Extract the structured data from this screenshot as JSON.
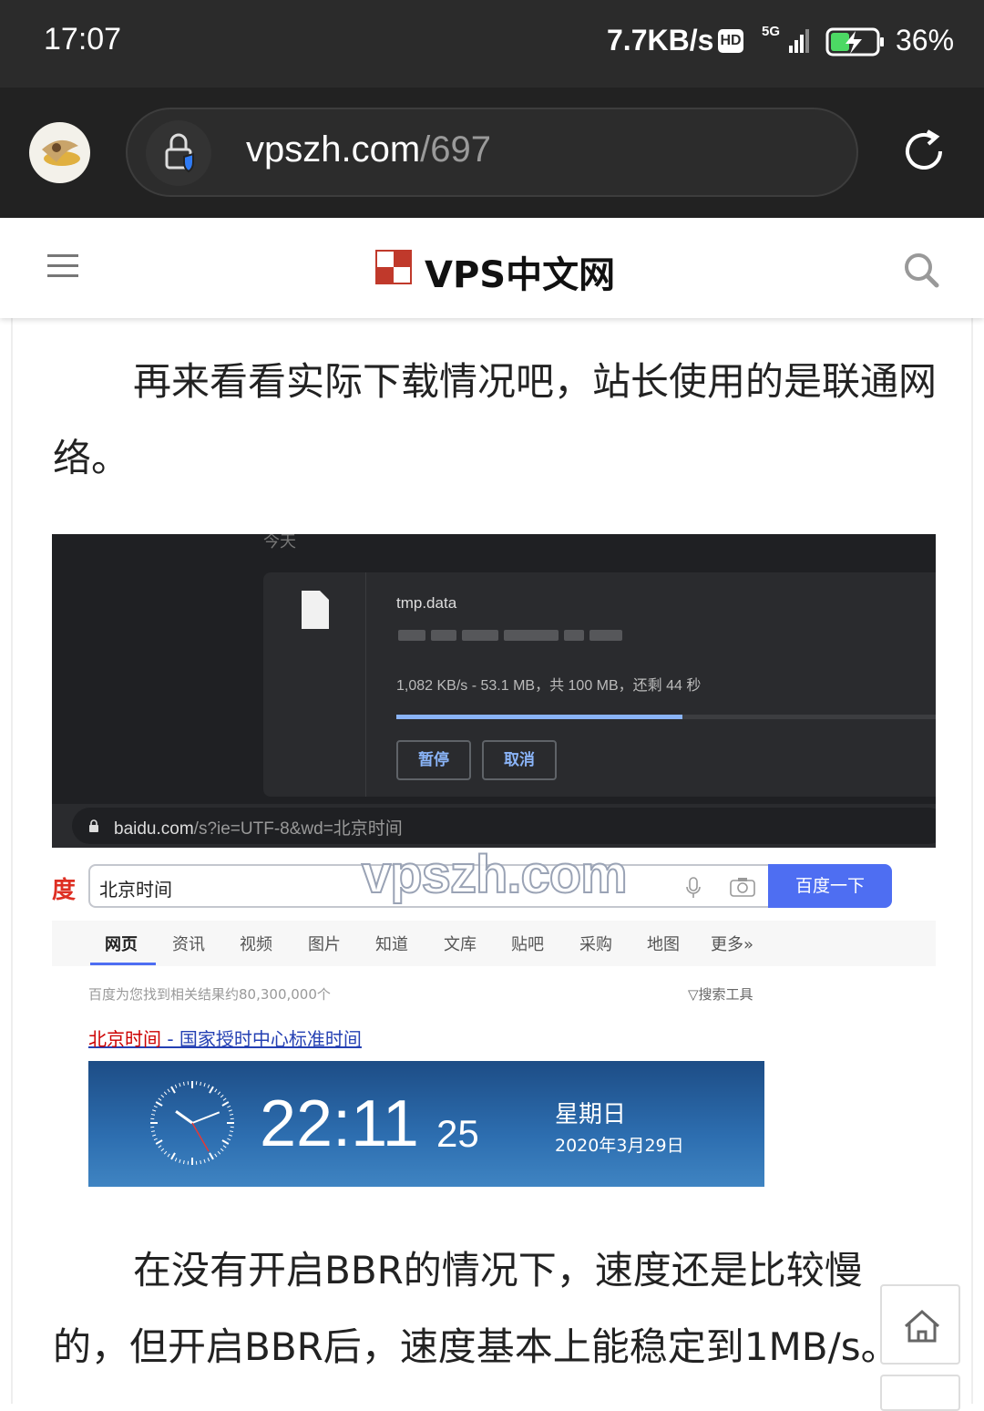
{
  "status_bar": {
    "time": "17:07",
    "net_speed": "7.7KB/s",
    "hd_badge": "HD",
    "network": "5G",
    "battery": "36%",
    "battery_level": 0.36
  },
  "browser": {
    "url_domain": "vpszh.com",
    "url_path": "/697"
  },
  "site_header": {
    "name": "VPS中文网",
    "logo_text": "VPS中文网"
  },
  "article": {
    "para1": "再来看看实际下载情况吧，站长使用的是联通网络。",
    "para2": "在没有开启BBR的情况下，速度还是比较慢的，但开启BBR后，速度基本上能稳定到1MB/s。"
  },
  "screenshot": {
    "today_label": "今天",
    "file_name": "tmp.data",
    "progress_text": "1,082 KB/s - 53.1 MB，共 100 MB，还剩 44 秒",
    "progress": 0.531,
    "pause_label": "暂停",
    "cancel_label": "取消",
    "address_host": "baidu.com",
    "address_query": "/s?ie=UTF-8&wd=北京时间",
    "watermark": "vpszh.com",
    "baidu_logo": "度",
    "search_value": "北京时间",
    "search_button": "百度一下",
    "tabs": [
      "网页",
      "资讯",
      "视频",
      "图片",
      "知道",
      "文库",
      "贴吧",
      "采购",
      "地图",
      "更多»"
    ],
    "result_count": "百度为您找到相关结果约80,300,000个",
    "search_tools": "搜索工具",
    "result_title_highlight": "北京时间",
    "result_title_rest": " - 国家授时中心标准时间",
    "clock_time": "22:11",
    "clock_seconds": "25",
    "weekday": "星期日",
    "date": "2020年3月29日"
  }
}
